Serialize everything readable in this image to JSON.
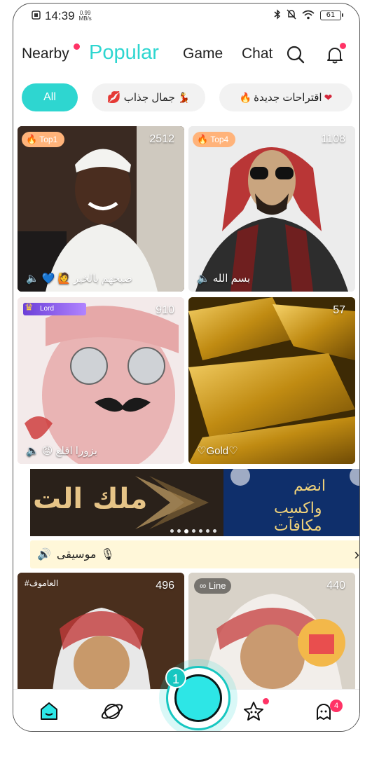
{
  "status_bar": {
    "time": "14:39",
    "net_speed_value": "0.99",
    "net_speed_unit": "MB/s",
    "battery": "61"
  },
  "top_nav": {
    "items": [
      "Nearby",
      "Popular",
      "Game",
      "Chat"
    ],
    "active": "Popular"
  },
  "chips": {
    "all": "All",
    "beauty": "جمال جذاب",
    "suggestions": "اقتراحات جديدة"
  },
  "tiles": [
    {
      "count": "2512",
      "badge": "Top1",
      "caption": "صبحهم بالخير"
    },
    {
      "count": "1108",
      "badge": "Top4",
      "caption": "بسم الله"
    },
    {
      "count": "910",
      "badge": "Lord",
      "caption": "بزورا اقلع"
    },
    {
      "count": "57",
      "badge": "",
      "caption": "♡Gold♡"
    },
    {
      "count": "496",
      "badge": "#العاموف",
      "caption": ""
    },
    {
      "count": "440",
      "badge": "Line",
      "caption": ""
    }
  ],
  "banner": {
    "left_text": "ملك الت",
    "right_line1": "انضم",
    "right_line2": "واكسب مكافآت"
  },
  "music": {
    "label": "موسيقى"
  },
  "bottom_nav": {
    "live_badge": "1",
    "messages_badge": "4"
  },
  "colors": {
    "accent": "#2ed6d0",
    "notify": "#ff3366"
  }
}
